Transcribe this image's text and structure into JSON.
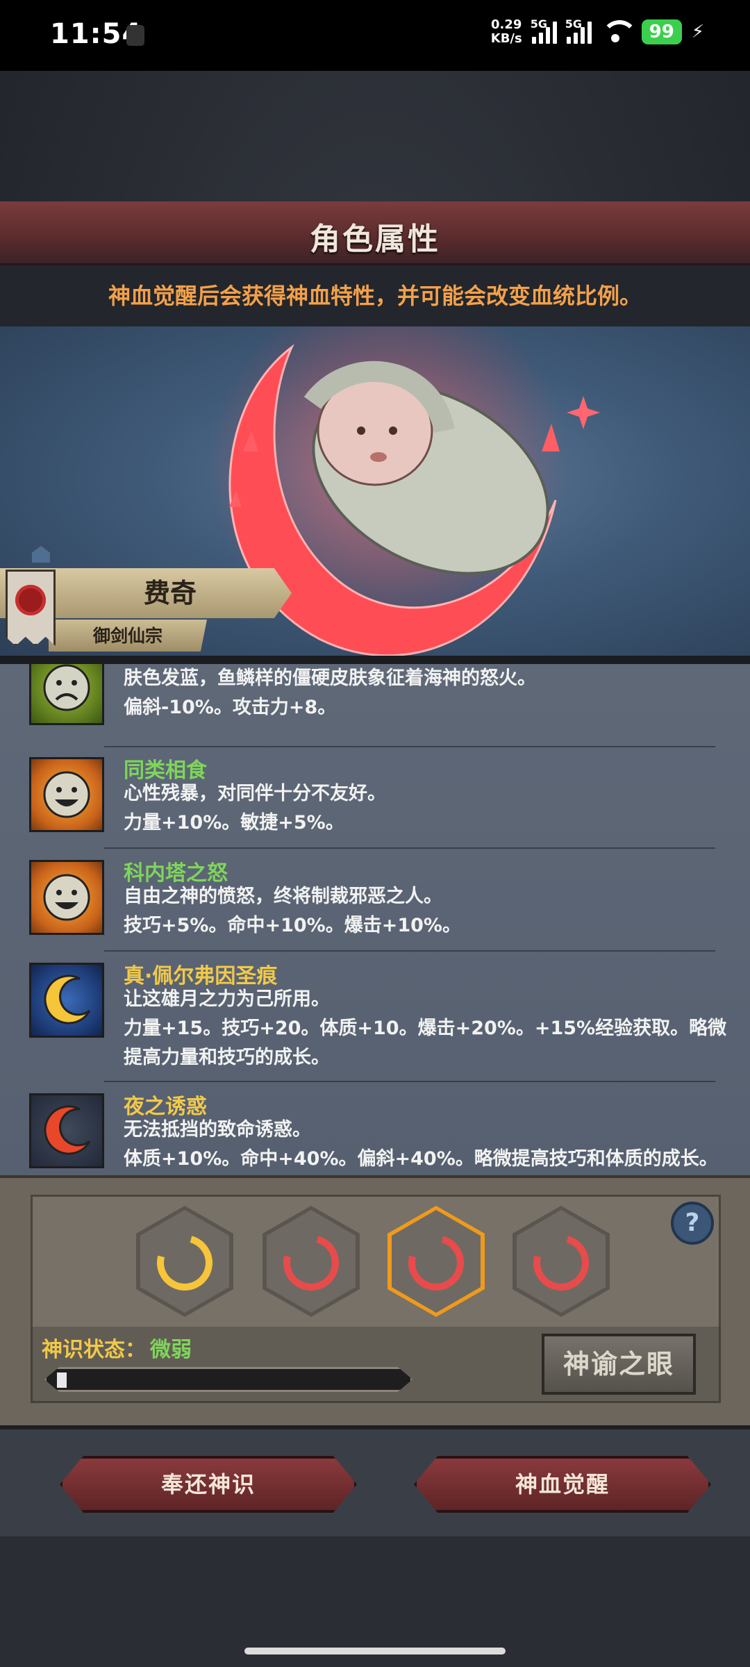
{
  "status_bar": {
    "time": "11:54",
    "net_rate_top": "0.29",
    "net_rate_bottom": "KB/s",
    "sim1": "5G",
    "sim2": "5G",
    "battery": "99"
  },
  "header": {
    "title": "角色属性",
    "notice": "神血觉醒后会获得神血特性，并可能会改变血统比例。"
  },
  "character": {
    "name": "费奇",
    "sect": "御剑仙宗"
  },
  "traits": [
    {
      "name": "",
      "name_color": "#7fd55a",
      "icon": "frown-face-icon",
      "desc_line1": "肤色发蓝，鱼鳞样的僵硬皮肤象征着海神的怒火。",
      "desc_line2": "偏斜-10%。攻击力+8。"
    },
    {
      "name": "同类相食",
      "name_color": "#7fd55a",
      "icon": "smile-face-icon",
      "desc_line1": "心性残暴，对同伴十分不友好。",
      "desc_line2": "力量+10%。敏捷+5%。"
    },
    {
      "name": "科内塔之怒",
      "name_color": "#7fd55a",
      "icon": "smile-face-icon",
      "desc_line1": "自由之神的愤怒，终将制裁邪恶之人。",
      "desc_line2": "技巧+5%。命中+10%。爆击+10%。"
    },
    {
      "name": "真·佩尔弗因圣痕",
      "name_color": "#f1c94a",
      "icon": "yellow-moon-icon",
      "desc_line1": "让这雄月之力为己所用。",
      "desc_line2": "力量+15。技巧+20。体质+10。爆击+20%。+15%经验获取。略微",
      "desc_line3": "提高力量和技巧的成长。"
    },
    {
      "name": "夜之诱惑",
      "name_color": "#f1c94a",
      "icon": "red-moon-icon",
      "desc_line1": "无法抵挡的致命诱惑。",
      "desc_line2": "体质+10%。命中+40%。偏斜+40%。略微提高技巧和体质的成长。"
    }
  ],
  "awakening": {
    "slots": [
      {
        "icon": "yellow-crescent-icon",
        "selected": false
      },
      {
        "icon": "red-crescent-icon",
        "selected": false
      },
      {
        "icon": "red-crescent-icon",
        "selected": true
      },
      {
        "icon": "red-crescent-icon",
        "selected": false
      }
    ],
    "help_label": "?",
    "status_label": "神识状态：",
    "status_value": "微弱",
    "progress_fraction": 0.02,
    "oracle_button": "神谕之眼"
  },
  "actions": {
    "return_button": "奉还神识",
    "awaken_button": "神血觉醒"
  }
}
